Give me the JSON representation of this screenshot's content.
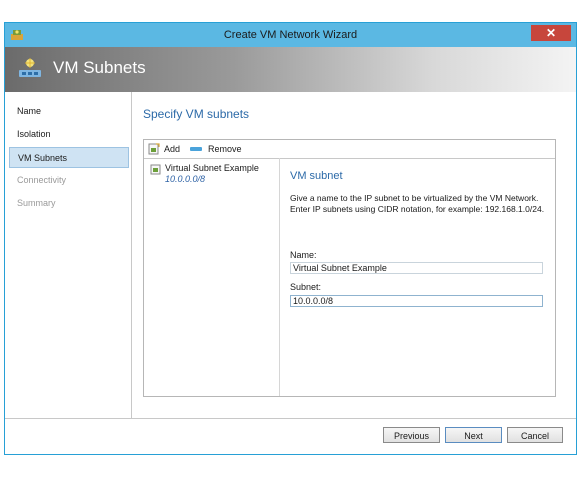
{
  "window": {
    "title": "Create VM Network Wizard",
    "close_glyph": "✕"
  },
  "banner": {
    "title": "VM Subnets"
  },
  "nav": {
    "items": [
      {
        "label": "Name",
        "state": "normal"
      },
      {
        "label": "Isolation",
        "state": "normal"
      },
      {
        "label": "VM Subnets",
        "state": "active"
      },
      {
        "label": "Connectivity",
        "state": "disabled"
      },
      {
        "label": "Summary",
        "state": "disabled"
      }
    ]
  },
  "main": {
    "title": "Specify VM subnets"
  },
  "toolbar": {
    "add_label": "Add",
    "remove_label": "Remove"
  },
  "subnet_list": {
    "items": [
      {
        "name": "Virtual Subnet Example",
        "address": "10.0.0.0/8"
      }
    ]
  },
  "detail": {
    "title": "VM subnet",
    "description": "Give a name to the IP subnet to be virtualized by the VM Network. Enter IP subnets using CIDR notation, for example: 192.168.1.0/24.",
    "name_label": "Name:",
    "name_value": "Virtual Subnet Example",
    "subnet_label": "Subnet:",
    "subnet_value": "10.0.0.0/8"
  },
  "footer": {
    "previous_label": "Previous",
    "next_label": "Next",
    "cancel_label": "Cancel"
  },
  "colors": {
    "titlebar": "#5bb8e3",
    "close": "#c7463c",
    "accent_text": "#2c6aa8",
    "nav_active": "#cfe3f3"
  }
}
